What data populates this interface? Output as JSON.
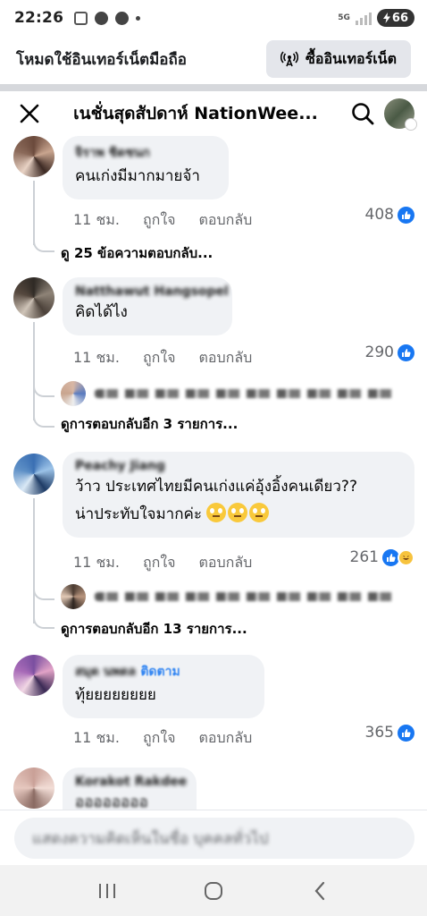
{
  "status_bar": {
    "time": "22:26",
    "network": "5G",
    "battery": "66"
  },
  "banner": {
    "text": "โหมดใช้อินเทอร์เน็ตมือถือ",
    "button_label": "ซื้ออินเทอร์เน็ต"
  },
  "header": {
    "title": "เนชั่นสุดสัปดาห์ NationWee..."
  },
  "comments": [
    {
      "author": "จิราพ ชิดชนก",
      "text": "คนเก่งมีมากมายจ้า",
      "time": "11 ชม.",
      "like": "ถูกใจ",
      "reply": "ตอบกลับ",
      "reactions": "408",
      "more": "ดู 25 ข้อความตอบกลับ..."
    },
    {
      "author": "Natthawut Hangsopel",
      "text": "คิดได้ไง",
      "time": "11 ชม.",
      "like": "ถูกใจ",
      "reply": "ตอบกลับ",
      "reactions": "290",
      "more": "ดูการตอบกลับอีก 3 รายการ..."
    },
    {
      "author": "Peachy Jiang",
      "text_line1": "ว้าว ประเทศไทยมีคนเก่งแค่อุ้งอิ้งคนเดียว??",
      "text_line2": "น่าประทับใจมากค่ะ",
      "time": "11 ชม.",
      "like": "ถูกใจ",
      "reply": "ตอบกลับ",
      "reactions": "261",
      "more": "ดูการตอบกลับอีก 13 รายการ..."
    },
    {
      "author": "สมุด นพดล",
      "author_suffix": "ติดตาม",
      "text": "ทุ้ยยยยยยยย",
      "time": "11 ชม.",
      "like": "ถูกใจ",
      "reply": "ตอบกลับ",
      "reactions": "365"
    },
    {
      "author": "Korakot Rakdee",
      "text": "ออออออออ"
    }
  ],
  "composer": {
    "placeholder": "แสดงความคิดเห็นในชื่อ บุคคลทั่วไป"
  },
  "colors": {
    "accent": "#1877f2",
    "bubble": "#f0f2f5",
    "muted": "#65676b"
  }
}
